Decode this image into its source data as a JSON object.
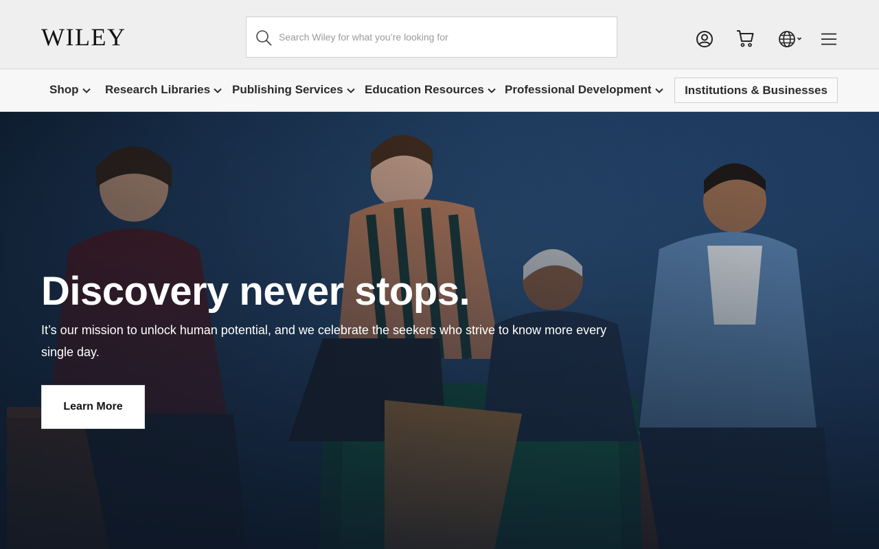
{
  "header": {
    "logo_text": "WILEY",
    "search": {
      "placeholder": "Search Wiley for what you’re looking for",
      "value": ""
    },
    "icons": [
      "account-icon",
      "cart-icon",
      "globe-icon",
      "menu-icon"
    ]
  },
  "nav": {
    "items": [
      {
        "label": "Shop"
      },
      {
        "label": "Research Libraries"
      },
      {
        "label": "Publishing Services"
      },
      {
        "label": "Education Resources"
      },
      {
        "label": "Professional Development"
      }
    ],
    "institutions_button": "Institutions & Businesses"
  },
  "hero": {
    "title": "Discovery never stops.",
    "text": "It’s our mission to unlock human potential, and we celebrate the seekers who strive to know more every single day.",
    "cta_label": "Learn More"
  },
  "colors": {
    "header_bg": "#efefef",
    "nav_bg": "#f7f7f7",
    "hero_bg": "#1f3a5c",
    "text_dark": "#2b2b2b"
  }
}
